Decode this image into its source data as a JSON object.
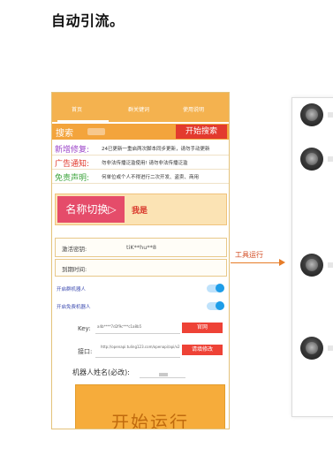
{
  "heading": "自动引流。",
  "tabs": [
    "首页",
    "群关键词",
    "使用说明"
  ],
  "search": {
    "label": "搜索",
    "button": "开始搜索"
  },
  "notices": [
    {
      "label": "新增修复:",
      "color": "#9b43c8",
      "text": "24已更新一重启两次脚本同步更新，请勿手动更新"
    },
    {
      "label": "广告通知:",
      "color": "#e0382c",
      "text": "勿非法传播泛滥使用!    请勿非法传播泛滥"
    },
    {
      "label": "免责声明:",
      "color": "#3fa53f",
      "text": "何单位或个人不得进行二次开发、盗卖、商用"
    }
  ],
  "rename": {
    "button": "名称切换▷",
    "tag": "我是"
  },
  "activation": {
    "label": "激活密钥:",
    "value": "tiK**hu**8"
  },
  "expiry": {
    "label": "到期时间:"
  },
  "toggles": [
    "开启群机器人",
    "开启免费机器人"
  ],
  "key_field": {
    "label": "Key:",
    "value": "a4b****7d2f9c***c1a8b5",
    "button": "官网"
  },
  "endpoint": {
    "label": "接口:",
    "value": "http://openapi.tuling123.com/openapi/api/v2",
    "button": "请填修改"
  },
  "bot_name": {
    "label": "机器人姓名(必改):"
  },
  "start": {
    "label": "开始运行"
  },
  "arrow_label": "工具运行",
  "right_panel": {
    "avatars": 4
  }
}
